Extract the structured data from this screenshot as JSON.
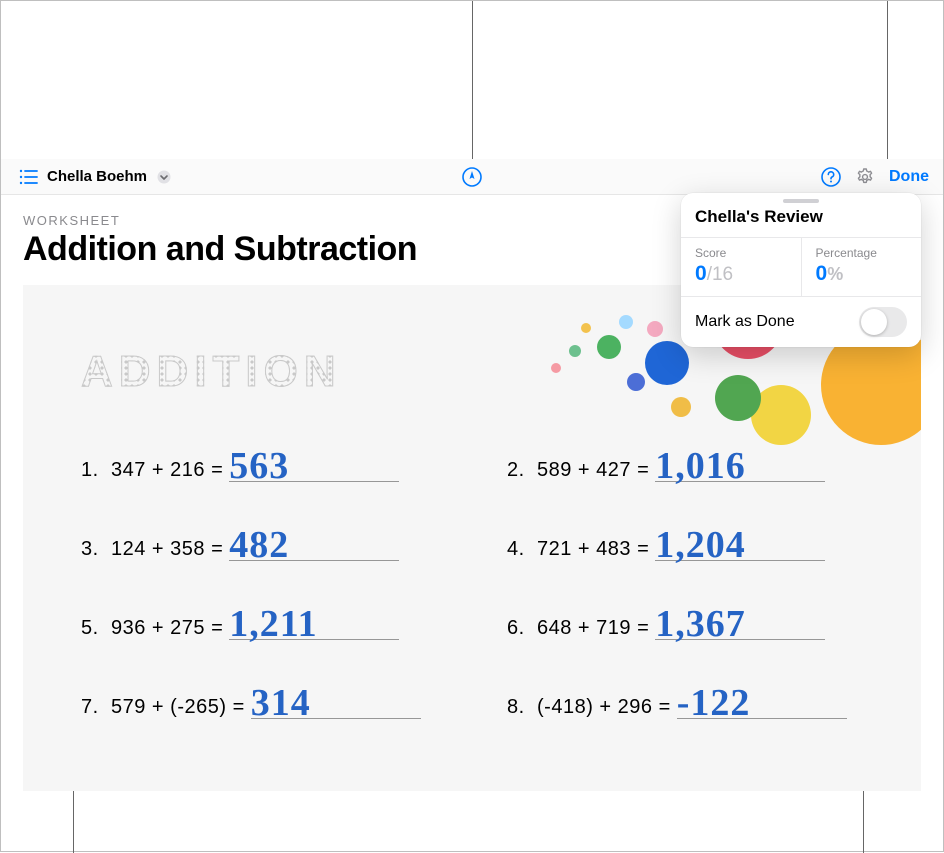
{
  "toolbar": {
    "student_name": "Chella Boehm",
    "done_label": "Done"
  },
  "worksheet": {
    "label": "WORKSHEET",
    "title": "Addition and Subtraction",
    "section_heading": "ADDITION"
  },
  "problems": [
    {
      "n": "1.",
      "eq": "347 + 216 =",
      "answer": "563"
    },
    {
      "n": "2.",
      "eq": "589 + 427 =",
      "answer": "1,016"
    },
    {
      "n": "3.",
      "eq": "124 + 358 =",
      "answer": "482"
    },
    {
      "n": "4.",
      "eq": "721 + 483 =",
      "answer": "1,204"
    },
    {
      "n": "5.",
      "eq": "936 + 275 =",
      "answer": "1,211"
    },
    {
      "n": "6.",
      "eq": "648 + 719 =",
      "answer": "1,367"
    },
    {
      "n": "7.",
      "eq": "579 + (-265) =",
      "answer": "314"
    },
    {
      "n": "8.",
      "eq": "(-418) + 296 =",
      "answer": "-122"
    }
  ],
  "review": {
    "title": "Chella's Review",
    "score_label": "Score",
    "score_value": "0",
    "score_total": "/16",
    "percentage_label": "Percentage",
    "percentage_value": "0",
    "percentage_symbol": "%",
    "mark_done_label": "Mark as Done"
  },
  "colors": {
    "accent": "#007aff"
  }
}
